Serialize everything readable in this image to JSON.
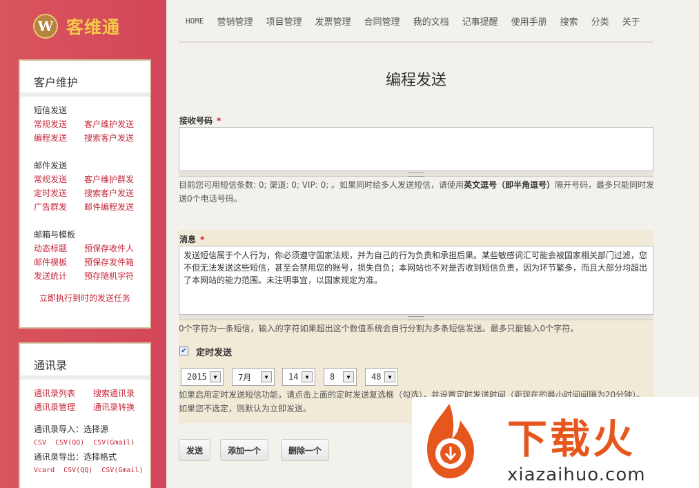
{
  "logo": {
    "mark": "W",
    "text": "客维通"
  },
  "sidebar": {
    "panel1": {
      "title": "客户维护",
      "sms_title": "短信发送",
      "sms_links": [
        [
          "常规发送",
          "客户维护发送"
        ],
        [
          "编程发送",
          "搜索客户发送"
        ]
      ],
      "mail_title": "邮件发送",
      "mail_links": [
        [
          "常规发送",
          "客户维护群发"
        ],
        [
          "定时发送",
          "搜索客户发送"
        ],
        [
          "广告群发",
          "邮件编程发送"
        ]
      ],
      "box_title": "邮箱与模板",
      "box_links": [
        [
          "动态标题",
          "预保存收件人"
        ],
        [
          "邮件模板",
          "预保存发件箱"
        ],
        [
          "发送统计",
          "预存随机字符"
        ]
      ],
      "run_link": "立即执行到时的发送任务"
    },
    "panel2": {
      "title": "通讯录",
      "links": [
        [
          "通讯录列表",
          "搜索通讯录"
        ],
        [
          "通讯录管理",
          "通讯录转换"
        ]
      ],
      "import_label": "通讯录导入：选择源",
      "import_links": [
        "CSV",
        "CSV(QQ)",
        "CSV(Gmail)"
      ],
      "export_label": "通讯录导出：选择格式",
      "export_links": [
        "Vcard",
        "CSV(QQ)",
        "CSV(Gmail)"
      ]
    }
  },
  "nav": [
    "HOME",
    "营销管理",
    "项目管理",
    "发票管理",
    "合同管理",
    "我的文档",
    "记事提醒",
    "使用手册",
    "搜索",
    "分类",
    "关于"
  ],
  "page_title": "编程发送",
  "receiver": {
    "label": "接收号码",
    "required": "*",
    "value": "",
    "help_1": "目前您可用短信条数: ",
    "count": "0",
    "help_2": "; 渠道: ",
    "channel": "0",
    "help_3": "; VIP: ",
    "vip": "0",
    "help_4": "; 。如果同时给多人发送短信，请使用",
    "help_bold": "英文逗号（即半角逗号）",
    "help_5": "隔开号码，最多只能同时发送",
    "max_count": "0",
    "help_6": "个电话号码。"
  },
  "message": {
    "label": "消息",
    "required": "*",
    "value": "发送短信属于个人行为，你必须遵守国家法规，并为自己的行为负责和承担后果。某些敏感词汇可能会被国家相关部门过滤，您不但无法发送这些短信，甚至会禁用您的账号，损失自负；本网站也不对是否收到短信负责，因为环节繁多，而且大部分均超出了本网站的能力范围。未注明事宜，以国家规定为准。",
    "help": "0个字符为一条短信，输入的字符如果超出这个数值系统会自行分割为多条短信发送。最多只能输入0个字符。"
  },
  "schedule": {
    "checked": true,
    "label": "定时发送",
    "year": "2015",
    "month": "7月",
    "day": "14",
    "hour": "8",
    "minute": "48",
    "help_1": "如果启用定时发送短信功能，请点击上面的定时发送复选框（勾选），并设置定时发送时间（距现在的最小时间间隔为20分钟）。",
    "help_2": "如果您不选定，则默认为立即发送。"
  },
  "buttons": {
    "send": "发送",
    "add": "添加一个",
    "delete": "删除一个"
  },
  "watermark": {
    "cn": "下载火",
    "en": "xiazaihuo.com"
  },
  "colors": {
    "sidebar": "#d3475a",
    "link": "#c4283a",
    "logo_text": "#f6c948",
    "watermark": "#e6571e"
  }
}
